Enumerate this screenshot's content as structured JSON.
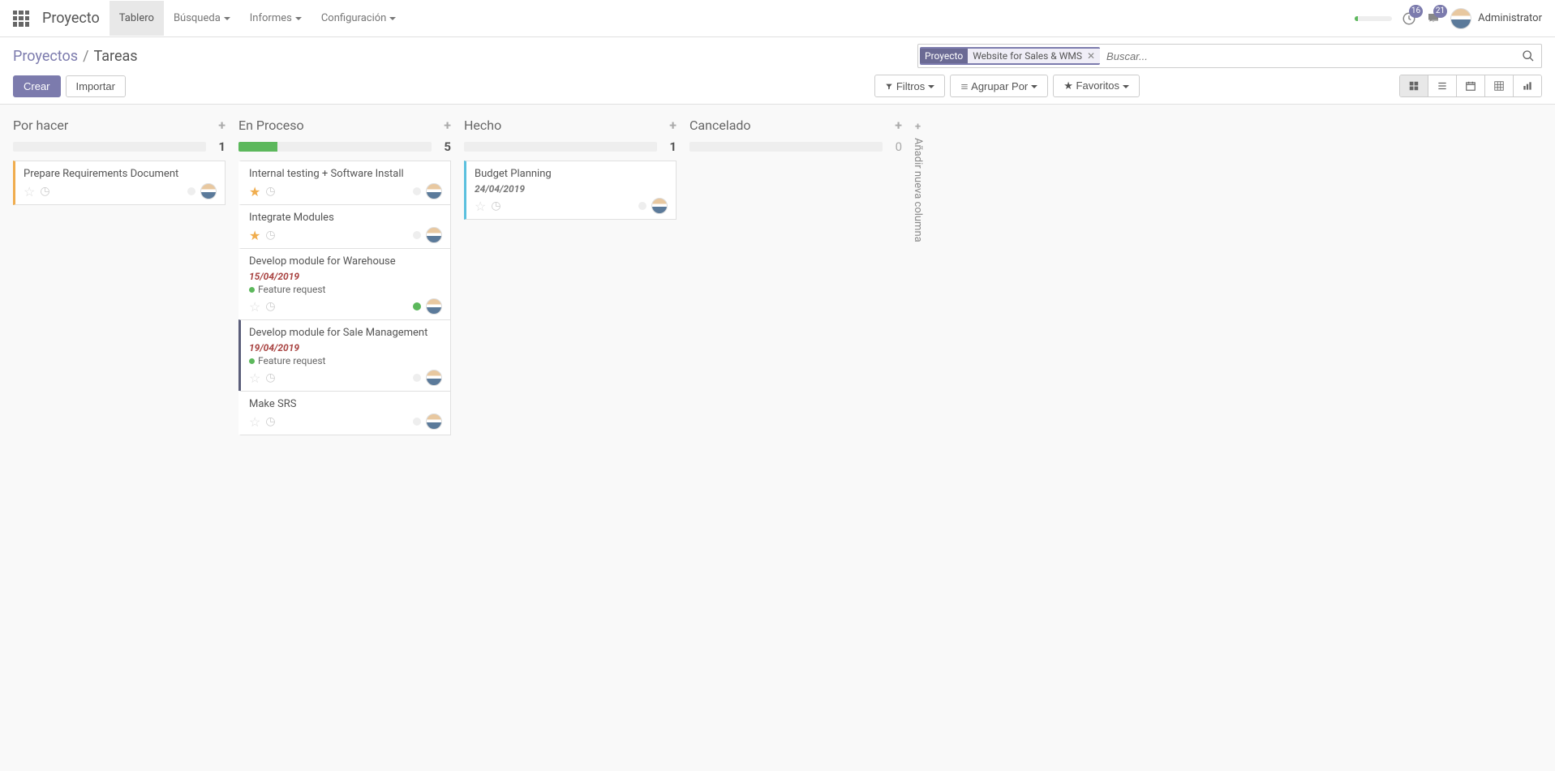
{
  "app_name": "Proyecto",
  "nav": {
    "tablero": "Tablero",
    "busqueda": "Búsqueda",
    "informes": "Informes",
    "config": "Configuración"
  },
  "notif_clock": "16",
  "notif_chat": "21",
  "user_name": "Administrator",
  "breadcrumb": {
    "root": "Proyectos",
    "current": "Tareas"
  },
  "search": {
    "facet_cat": "Proyecto",
    "facet_val": "Website for Sales & WMS",
    "placeholder": "Buscar..."
  },
  "buttons": {
    "crear": "Crear",
    "importar": "Importar"
  },
  "filters": {
    "filtros": "Filtros",
    "agrupar": "Agrupar Por",
    "favoritos": "Favoritos"
  },
  "columns": [
    {
      "title": "Por hacer",
      "count": "1",
      "progress_green": 0
    },
    {
      "title": "En Proceso",
      "count": "5",
      "progress_green": 20
    },
    {
      "title": "Hecho",
      "count": "1",
      "progress_green": 0
    },
    {
      "title": "Cancelado",
      "count": "0",
      "progress_green": 0
    }
  ],
  "cards_c0": [
    {
      "title": "Prepare Requirements Document"
    }
  ],
  "cards_c1": [
    {
      "title": "Internal testing + Software Install",
      "star": true
    },
    {
      "title": "Integrate Modules",
      "star": true
    },
    {
      "title": "Develop module for Warehouse",
      "date": "15/04/2019",
      "tag": "Feature request",
      "tag_color": "#5cb85c",
      "dot_green": true
    },
    {
      "title": "Develop module for Sale Management",
      "date": "19/04/2019",
      "tag": "Feature request",
      "tag_color": "#5cb85c",
      "stripe": "purple"
    },
    {
      "title": "Make SRS"
    }
  ],
  "cards_c2": [
    {
      "title": "Budget Planning",
      "date": "24/04/2019",
      "date_gray": true
    }
  ],
  "add_column": "Añadir nueva columna"
}
